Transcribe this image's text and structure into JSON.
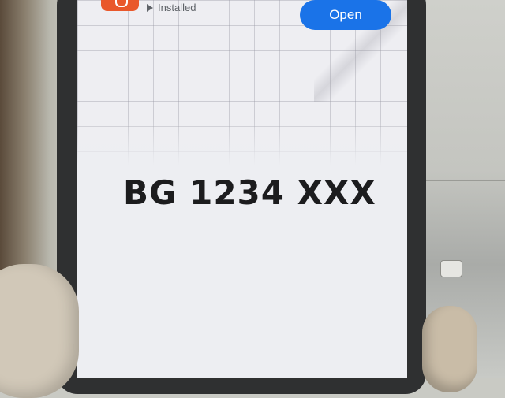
{
  "app_banner": {
    "status": "Installed",
    "open_button": "Open",
    "icon": "play-store-icon",
    "app_icon": "app-logo-icon",
    "accent_color": "#1a73e8",
    "app_icon_color": "#e9582b"
  },
  "screen": {
    "plate_text": "BG 1234 XXX",
    "background": "grid"
  }
}
